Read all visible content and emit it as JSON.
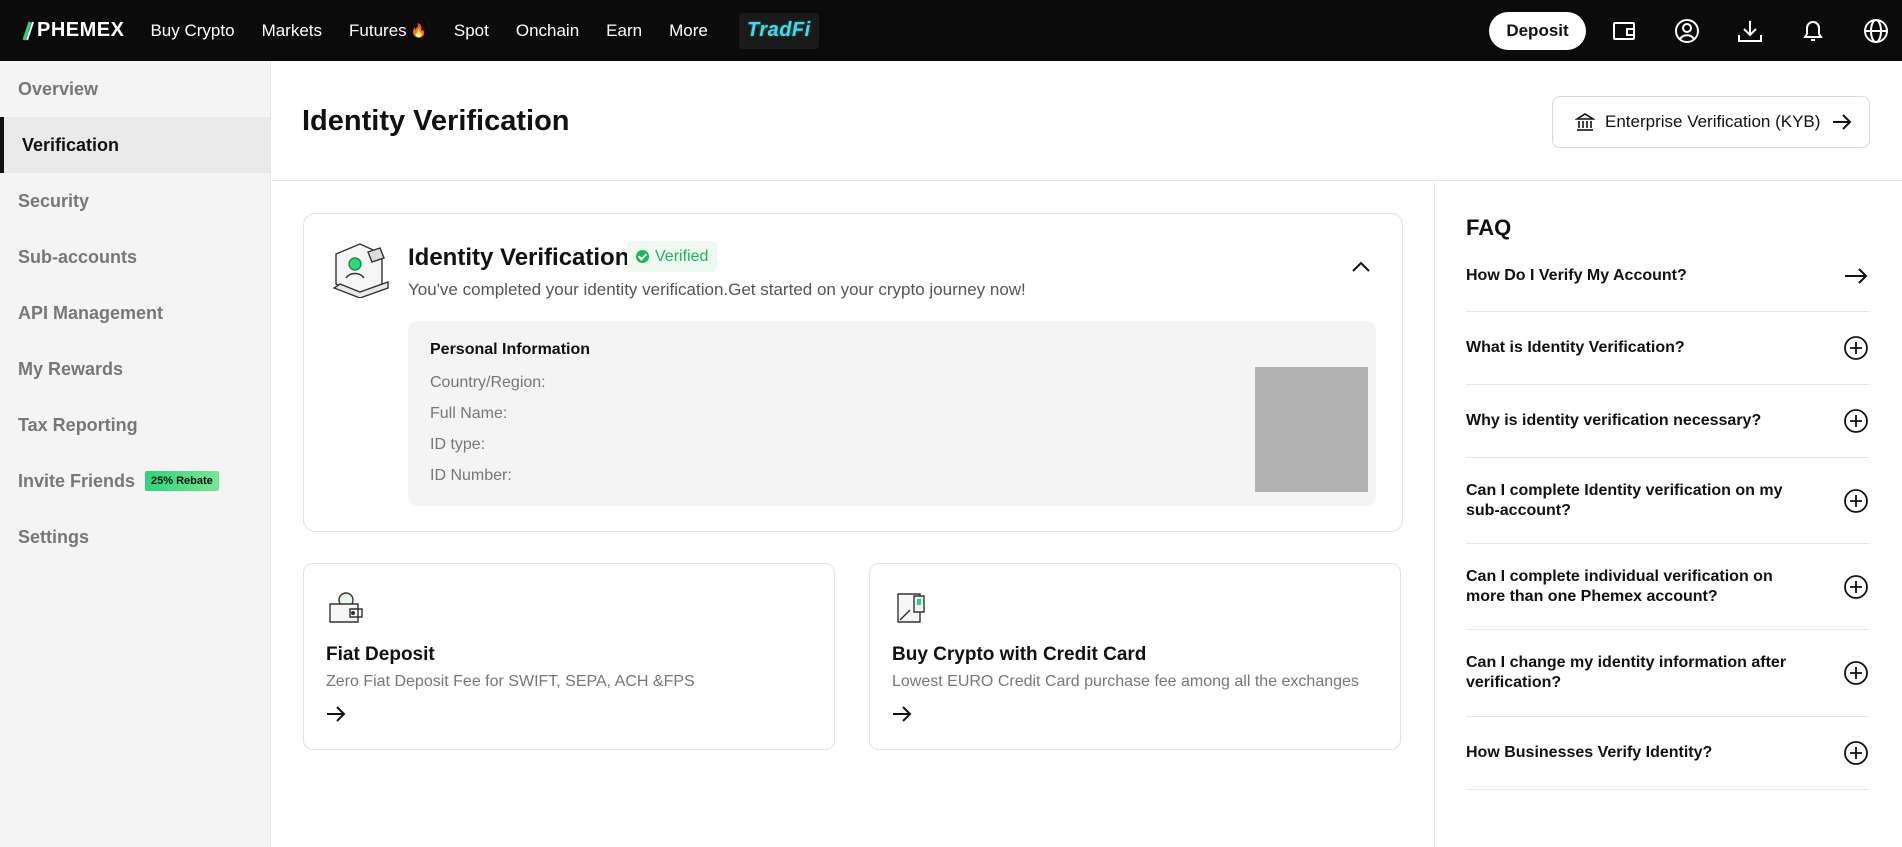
{
  "topnav": {
    "logo_text": "PHEMEX",
    "links": [
      "Buy Crypto",
      "Markets",
      "Futures",
      "Spot",
      "Onchain",
      "Earn",
      "More"
    ],
    "futures_badge_icon": "fire-icon",
    "tradfi_label": "TradFi",
    "deposit_label": "Deposit",
    "icons": [
      "wallet-icon",
      "account-icon",
      "download-icon",
      "bell-icon",
      "globe-icon"
    ]
  },
  "sidebar": {
    "items": [
      {
        "label": "Overview"
      },
      {
        "label": "Verification",
        "active": true
      },
      {
        "label": "Security"
      },
      {
        "label": "Sub-accounts"
      },
      {
        "label": "API Management"
      },
      {
        "label": "My Rewards"
      },
      {
        "label": "Tax Reporting"
      },
      {
        "label": "Invite Friends",
        "badge": "25% Rebate"
      },
      {
        "label": "Settings"
      }
    ]
  },
  "header": {
    "title": "Identity Verification",
    "kyb_button": "Enterprise Verification (KYB)"
  },
  "identity": {
    "title": "Identity Verification",
    "status": "Verified",
    "subtitle": "You've completed your identity verification.Get started on your crypto journey now!",
    "personal_info": {
      "heading": "Personal Information",
      "fields": [
        "Country/Region:",
        "Full Name:",
        "ID type:",
        "ID Number:"
      ]
    }
  },
  "cards": [
    {
      "title": "Fiat Deposit",
      "desc": "Zero Fiat Deposit Fee for SWIFT, SEPA, ACH &FPS",
      "icon": "wallet-coin-icon"
    },
    {
      "title": "Buy Crypto with Credit Card",
      "desc": "Lowest EURO Credit Card purchase fee among all the exchanges",
      "icon": "credit-card-icon"
    }
  ],
  "faq": {
    "title": "FAQ",
    "items": [
      {
        "q": "How Do I Verify My Account?",
        "icon": "arrow-right-icon"
      },
      {
        "q": "What is Identity Verification?",
        "icon": "plus-circle-icon"
      },
      {
        "q": "Why is identity verification necessary?",
        "icon": "plus-circle-icon"
      },
      {
        "q": "Can I complete Identity verification on my sub-account?",
        "icon": "plus-circle-icon"
      },
      {
        "q": "Can I complete individual verification on more than one Phemex account?",
        "icon": "plus-circle-icon"
      },
      {
        "q": "Can I change my identity information after verification?",
        "icon": "plus-circle-icon"
      },
      {
        "q": "How Businesses Verify Identity?",
        "icon": "plus-circle-icon"
      }
    ]
  },
  "colors": {
    "nav_bg": "#0b0b0b",
    "verified_green": "#1fb35a",
    "rebate_green": "#2ed47a",
    "sidebar_bg": "#f4f4f4"
  }
}
